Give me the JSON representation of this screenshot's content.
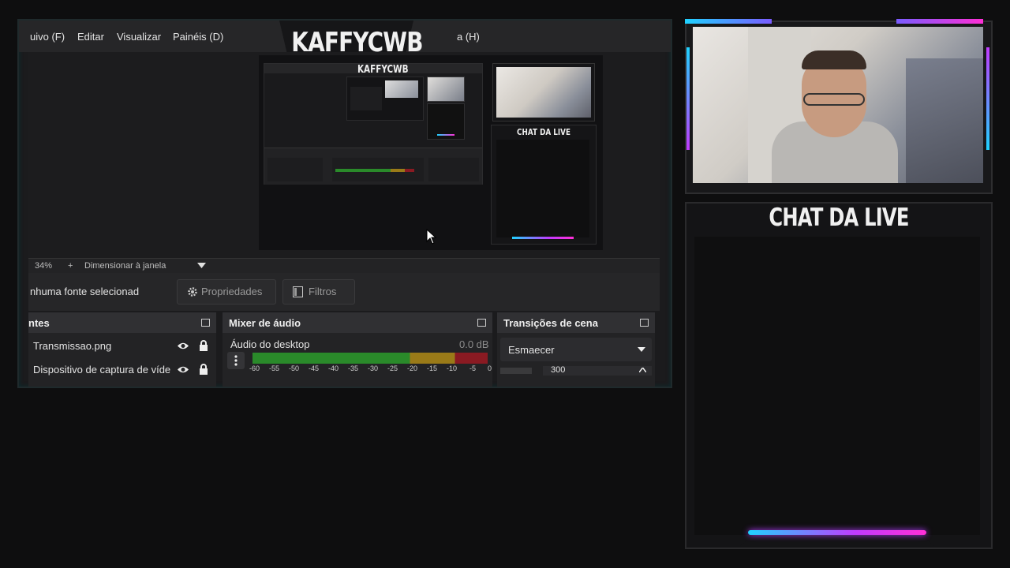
{
  "obs": {
    "menu": [
      "uivo (F)",
      "Editar",
      "Visualizar",
      "Painéis (D)",
      "a (H)"
    ],
    "overlay_title": "KAFFYCWB",
    "zoom": {
      "percent": "34%",
      "plus": "+",
      "fit_label": "Dimensionar à janela"
    },
    "source_bar": {
      "no_source": "nhuma fonte selecionad",
      "properties": "Propriedades",
      "filters": "Filtros"
    },
    "sources_dock": {
      "title": "ntes",
      "items": [
        {
          "label": "Transmissao.png"
        },
        {
          "label": "Dispositivo de captura de víde"
        }
      ]
    },
    "mixer_dock": {
      "title": "Mixer de áudio",
      "channel": "Áudio do desktop",
      "db": "0.0 dB",
      "scale": [
        "-60",
        "-55",
        "-50",
        "-45",
        "-40",
        "-35",
        "-30",
        "-25",
        "-20",
        "-15",
        "-10",
        "-5",
        "0"
      ]
    },
    "transitions_dock": {
      "title": "Transições de cena",
      "selected": "Esmaecer",
      "duration_value": "300"
    }
  },
  "mini": {
    "title": "KAFFYCWB",
    "chat": "CHAT DA LIVE"
  },
  "chat": {
    "title": "CHAT DA LIVE"
  },
  "colors": {
    "accent_cyan": "#1fd2ff",
    "accent_magenta": "#c03bff",
    "meter_green": "#2a8a2a",
    "meter_yellow": "#9a7a18",
    "meter_red": "#8a1a22"
  }
}
